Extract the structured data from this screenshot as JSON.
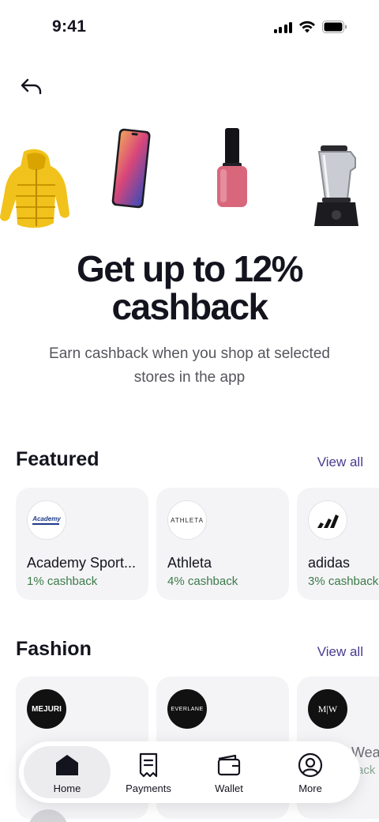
{
  "status_bar": {
    "time": "9:41"
  },
  "hero": {
    "title_line1": "Get up to 12%",
    "title_line2": "cashback",
    "subtitle": "Earn cashback when you shop at selected stores in the app"
  },
  "featured": {
    "title": "Featured",
    "view_all": "View all",
    "stores": [
      {
        "name": "Academy Sport...",
        "cashback": "1% cashback",
        "logo_text": "Academy"
      },
      {
        "name": "Athleta",
        "cashback": "4% cashback",
        "logo_text": "ATHLETA"
      },
      {
        "name": "adidas",
        "cashback": "3% cashback"
      }
    ]
  },
  "fashion": {
    "title": "Fashion",
    "view_all": "View all",
    "stores": [
      {
        "logo_text": "MEJURI"
      },
      {
        "logo_text": "EVERLANE"
      },
      {
        "logo_text": "M|W",
        "name": "Wea",
        "cashback": "ack"
      }
    ]
  },
  "bottom_nav": {
    "items": [
      {
        "label": "Home",
        "icon": "home-icon",
        "active": true
      },
      {
        "label": "Payments",
        "icon": "receipt-icon"
      },
      {
        "label": "Wallet",
        "icon": "wallet-icon"
      },
      {
        "label": "More",
        "icon": "user-circle-icon"
      }
    ]
  },
  "colors": {
    "accent": "#4a3b8f",
    "cashback_green": "#3b7a4a",
    "card_bg": "#f4f4f6"
  }
}
